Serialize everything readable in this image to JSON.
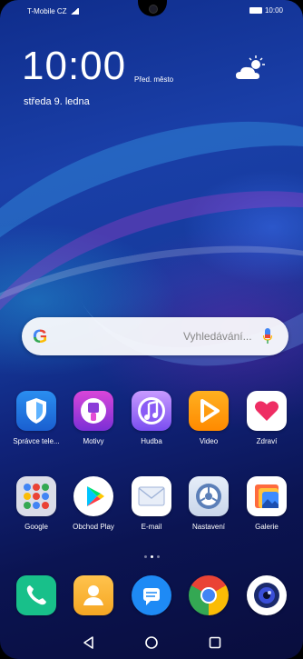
{
  "status": {
    "carrier": "T-Mobile CZ",
    "time": "10:00"
  },
  "lockclock": {
    "time": "10:00",
    "location": "Před. město",
    "date": "středa 9. ledna"
  },
  "search": {
    "placeholder": "Vyhledávání..."
  },
  "apps_row1": [
    {
      "name": "Správce tele...",
      "icon": "shield-icon"
    },
    {
      "name": "Motivy",
      "icon": "brush-icon"
    },
    {
      "name": "Hudba",
      "icon": "music-note-icon"
    },
    {
      "name": "Video",
      "icon": "play-icon"
    },
    {
      "name": "Zdraví",
      "icon": "heart-icon"
    }
  ],
  "apps_row2": [
    {
      "name": "Google",
      "icon": "folder-icon"
    },
    {
      "name": "Obchod Play",
      "icon": "play-store-icon"
    },
    {
      "name": "E-mail",
      "icon": "envelope-icon"
    },
    {
      "name": "Nastavení",
      "icon": "gear-icon"
    },
    {
      "name": "Galerie",
      "icon": "gallery-icon"
    }
  ],
  "dock": [
    {
      "icon": "phone-icon"
    },
    {
      "icon": "contacts-icon"
    },
    {
      "icon": "messages-icon"
    },
    {
      "icon": "chrome-icon"
    },
    {
      "icon": "camera-icon"
    }
  ],
  "page_indicator": {
    "pages": 3,
    "current": 2
  }
}
